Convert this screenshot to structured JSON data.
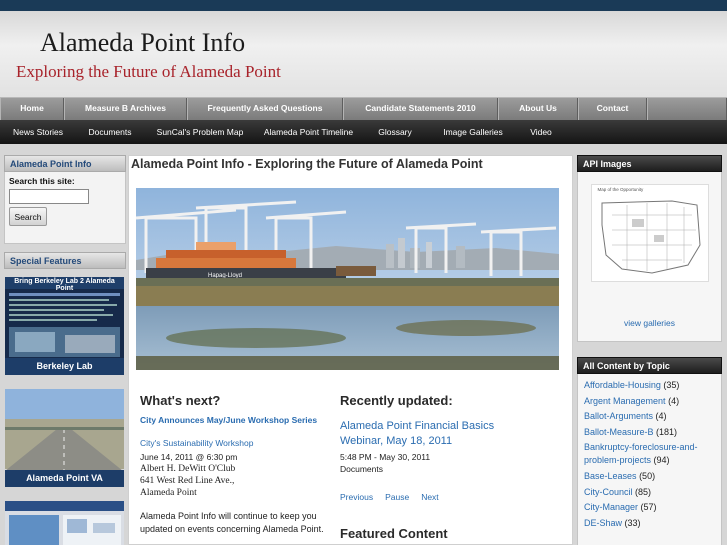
{
  "site": {
    "title": "Alameda Point Info",
    "subtitle": "Exploring the Future of Alameda Point"
  },
  "nav_primary": [
    "Home",
    "Measure B Archives",
    "Frequently Asked Questions",
    "Candidate Statements 2010",
    "About Us",
    "Contact"
  ],
  "nav_secondary": [
    "News Stories",
    "Documents",
    "SunCal's Problem Map",
    "Alameda Point Timeline",
    "Glossary",
    "Image Galleries",
    "Video"
  ],
  "left": {
    "block_title": "Alameda Point Info",
    "search_label": "Search this site:",
    "search_button": "Search",
    "special_title": "Special Features",
    "feature1": {
      "banner": "Bring Berkeley Lab 2 Alameda Point",
      "caption": "Berkeley Lab"
    },
    "feature2": {
      "caption": "Alameda Point VA"
    }
  },
  "main": {
    "title": "Alameda Point Info - Exploring the Future of Alameda Point",
    "whats_next": {
      "heading": "What's next?",
      "link1": "City Announces May/June Workshop Series",
      "link2": "City's Sustainability Workshop",
      "date": "June 14, 2011 @ 6:30 pm",
      "place": "Albert H. DeWitt O'Club",
      "address": "641 West Red Line Ave.,",
      "city": "Alameda Point",
      "text": "Alameda Point Info will continue to keep you updated on events concerning Alameda Point."
    },
    "recent": {
      "heading": "Recently updated:",
      "item_title": "Alameda Point Financial Basics Webinar, May 18, 2011",
      "item_date": "5:48 PM - May 30, 2011",
      "item_type": "Documents",
      "pager": [
        "Previous",
        "Pause",
        "Next"
      ],
      "featured_heading": "Featured Content"
    },
    "hero_text": "Hapag-Lloyd"
  },
  "right": {
    "api_title": "API Images",
    "map_label": "Map of the Opportunity",
    "view_galleries": "view galleries",
    "topics_title": "All Content by Topic",
    "topics": [
      {
        "name": "Affordable-Housing",
        "count": "(35)"
      },
      {
        "name": "Argent Management",
        "count": "(4)"
      },
      {
        "name": "Ballot-Arguments",
        "count": "(4)"
      },
      {
        "name": "Ballot-Measure-B",
        "count": "(181)"
      },
      {
        "name": "Bankruptcy-foreclosure-and-problem-projects",
        "count": "(94)"
      },
      {
        "name": "Base-Leases",
        "count": "(50)"
      },
      {
        "name": "City-Council",
        "count": "(85)"
      },
      {
        "name": "City-Manager",
        "count": "(57)"
      },
      {
        "name": "DE-Shaw",
        "count": "(33)"
      }
    ]
  },
  "colors": {
    "brand_red": "#a8222a",
    "link_blue": "#2a6cb0",
    "block_head_text": "#244a7a",
    "top_strip": "#1a3a57"
  }
}
